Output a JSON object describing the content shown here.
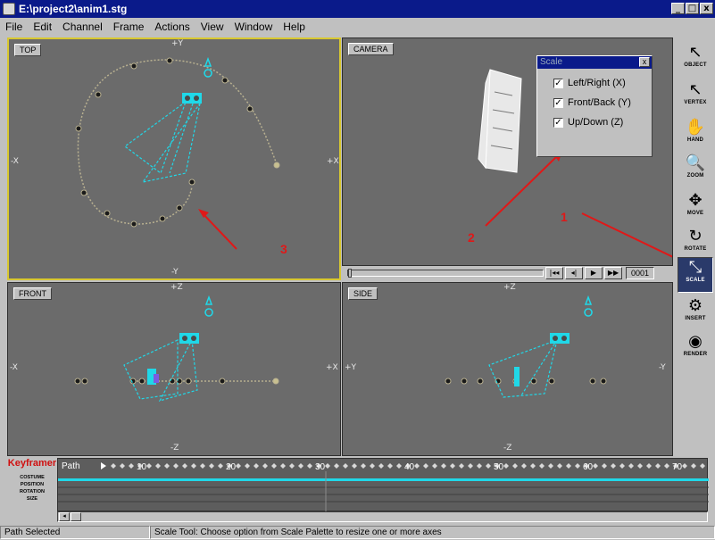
{
  "window": {
    "title": "E:\\project2\\anim1.stg",
    "buttons": [
      "_",
      "□",
      "x"
    ]
  },
  "menu": [
    "File",
    "Edit",
    "Channel",
    "Frame",
    "Actions",
    "View",
    "Window",
    "Help"
  ],
  "viewports": {
    "top": {
      "label": "TOP",
      "axis_top": "+Y",
      "axis_bottom": "-Y",
      "axis_left": "-X",
      "axis_right": "+X"
    },
    "camera": {
      "label": "CAMERA"
    },
    "front": {
      "label": "FRONT",
      "axis_top": "+Z",
      "axis_bottom": "-Z",
      "axis_left": "-X",
      "axis_right": "+X"
    },
    "side": {
      "label": "SIDE",
      "axis_top": "+Z",
      "axis_bottom": "-Z",
      "axis_left": "+Y",
      "axis_right": "-Y"
    }
  },
  "scale_palette": {
    "title": "Scale",
    "close": "x",
    "options": [
      {
        "label": "Left/Right (X)",
        "checked": true
      },
      {
        "label": "Front/Back (Y)",
        "checked": true
      },
      {
        "label": "Up/Down (Z)",
        "checked": true
      }
    ]
  },
  "camera_strip": {
    "buttons": [
      "|◂◂",
      "◂|",
      "▶",
      "▶▶"
    ],
    "frame": "0001"
  },
  "annotations": {
    "arrow1": "1",
    "arrow2": "2",
    "arrow3": "3"
  },
  "toolbar": [
    {
      "name": "object",
      "label": "OBJECT",
      "icon": "pointer-icon",
      "glyph": "↖"
    },
    {
      "name": "vertex",
      "label": "VERTEX",
      "icon": "vertex-pointer-icon",
      "glyph": "↖"
    },
    {
      "name": "hand",
      "label": "HAND",
      "icon": "hand-icon",
      "glyph": "✋"
    },
    {
      "name": "zoom",
      "label": "ZOOM",
      "icon": "magnifier-icon",
      "glyph": "🔍"
    },
    {
      "name": "move",
      "label": "MOVE",
      "icon": "move-arrows-icon",
      "glyph": "✥"
    },
    {
      "name": "rotate",
      "label": "ROTATE",
      "icon": "rotate-icon",
      "glyph": "↻"
    },
    {
      "name": "scale",
      "label": "SCALE",
      "icon": "scale-icon",
      "glyph": "⤡",
      "selected": true
    },
    {
      "name": "insert",
      "label": "INSERT",
      "icon": "insert-icon",
      "glyph": "⚙"
    },
    {
      "name": "render",
      "label": "RENDER",
      "icon": "render-icon",
      "glyph": "◉"
    }
  ],
  "keyframer": {
    "title": "Keyframer",
    "rows": [
      "COSTUME",
      "POSITION",
      "ROTATION",
      "SIZE"
    ],
    "path_label": "Path",
    "frame_marks": [
      "10",
      "20",
      "30",
      "40",
      "50",
      "60",
      "70"
    ]
  },
  "status": {
    "left": "Path Selected",
    "right": "Scale Tool: Choose option from Scale Palette to resize one or more axes"
  },
  "colors": {
    "viewport_bg": "#6b6b6b",
    "active_border": "#d8c830",
    "camera_cyan": "#20d8e8",
    "path": "#b8b090",
    "arrow_red": "#e01818",
    "title_blue": "#0a1a8a"
  }
}
